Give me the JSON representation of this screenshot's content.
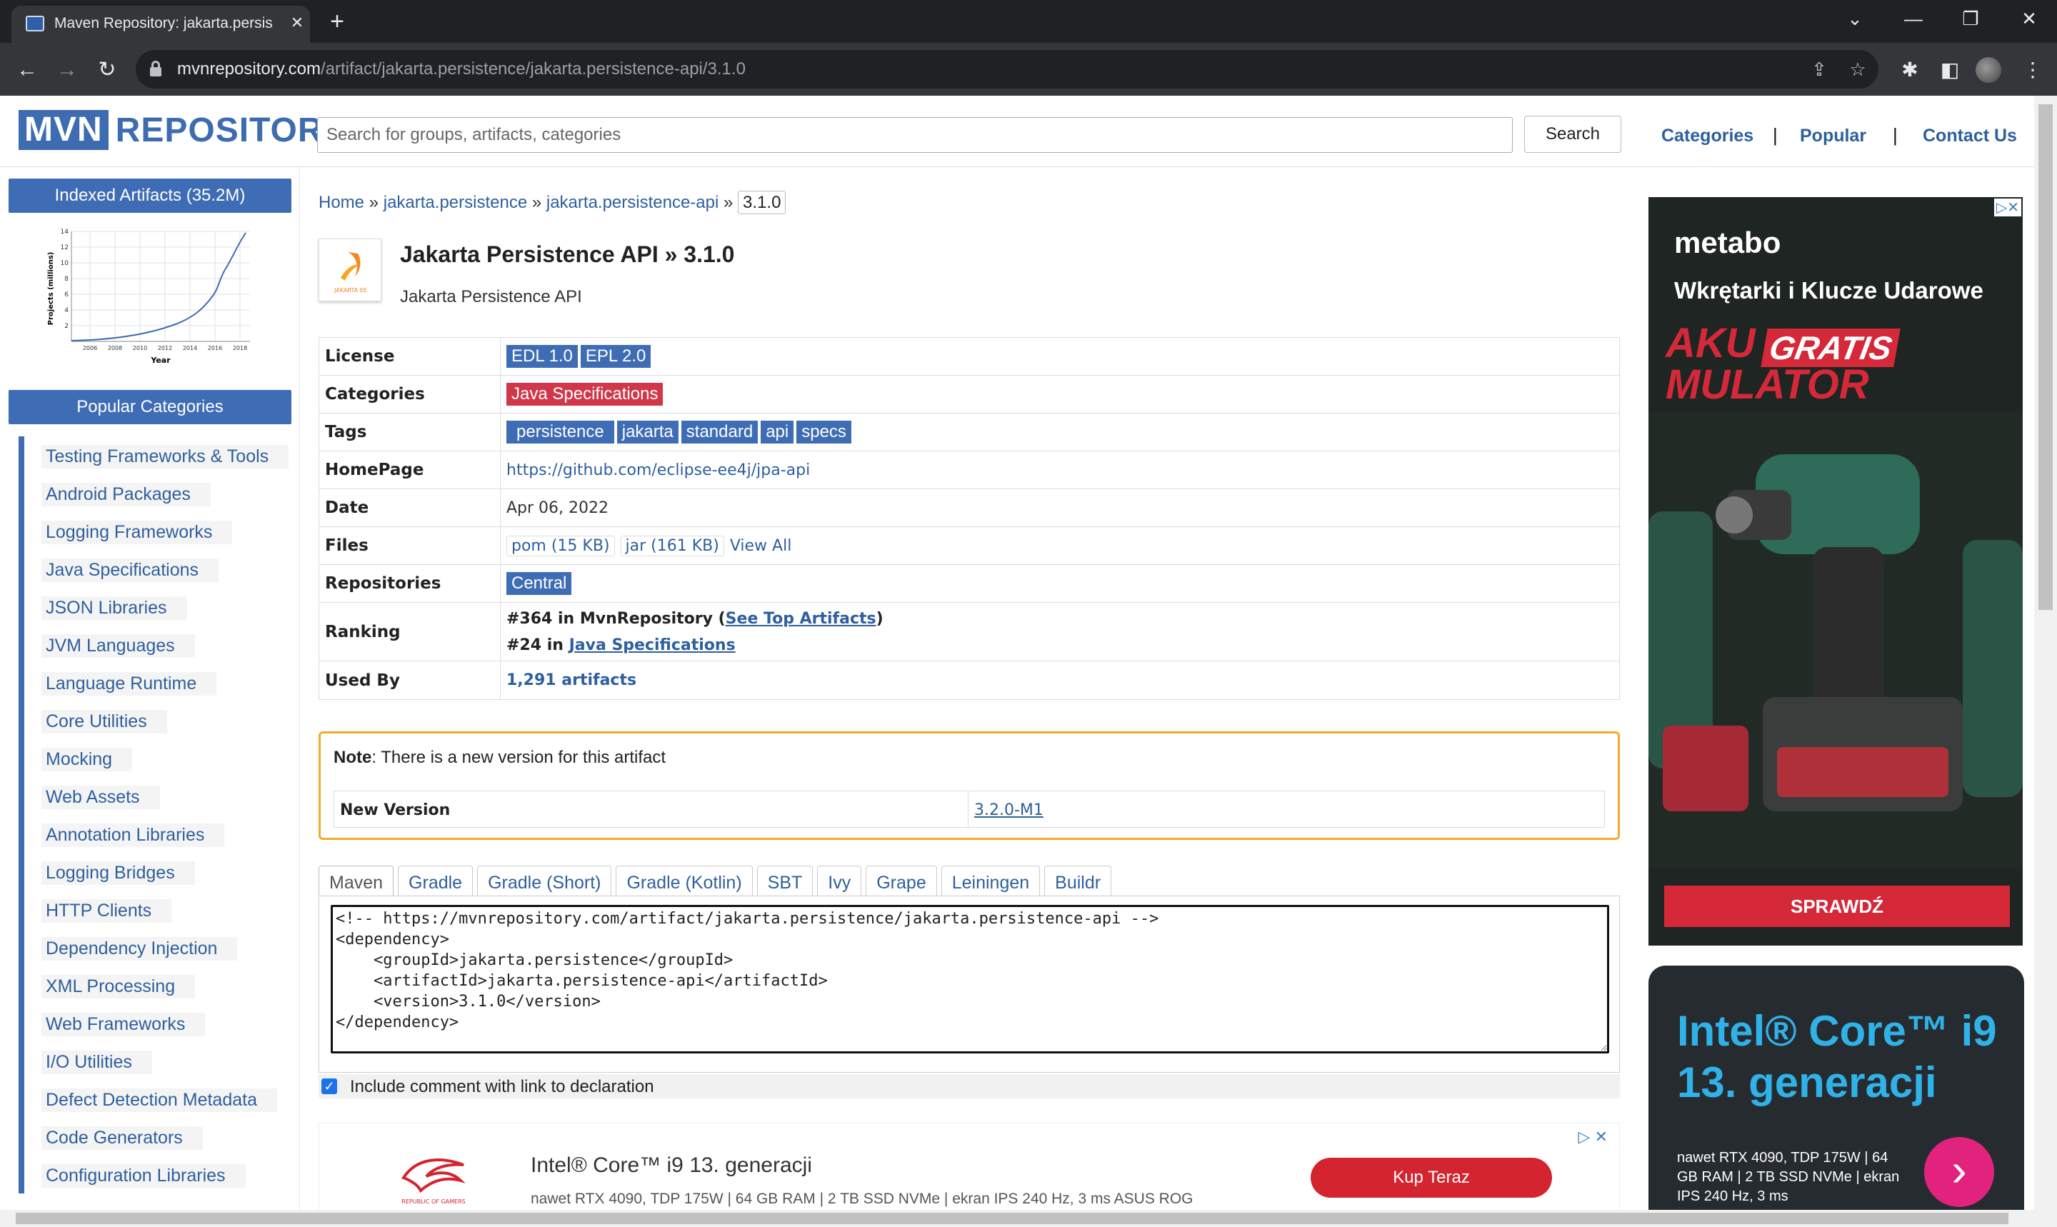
{
  "browser": {
    "tab_title": "Maven Repository: jakarta.persis",
    "url_host": "mvnrepository.com",
    "url_path": "/artifact/jakarta.persistence/jakarta.persistence-api/3.1.0"
  },
  "header": {
    "logo_mvn": "MVN",
    "logo_repository": "REPOSITORY",
    "search_placeholder": "Search for groups, artifacts, categories",
    "search_button": "Search",
    "nav": {
      "categories": "Categories",
      "popular": "Popular",
      "contact": "Contact Us"
    },
    "nav_separator": "|"
  },
  "sidebar": {
    "indexed_title": "Indexed Artifacts (35.2M)",
    "chart": {
      "ylabel": "Projects (millions)",
      "xlabel": "Year",
      "yticks": [
        "14",
        "12",
        "10",
        "8",
        "6",
        "4",
        "2"
      ],
      "xticks": [
        "2006",
        "2008",
        "2010",
        "2012",
        "2014",
        "2016",
        "2018"
      ]
    },
    "popular_title": "Popular Categories",
    "categories": [
      "Testing Frameworks & Tools",
      "Android Packages",
      "Logging Frameworks",
      "Java Specifications",
      "JSON Libraries",
      "JVM Languages",
      "Language Runtime",
      "Core Utilities",
      "Mocking",
      "Web Assets",
      "Annotation Libraries",
      "Logging Bridges",
      "HTTP Clients",
      "Dependency Injection",
      "XML Processing",
      "Web Frameworks",
      "I/O Utilities",
      "Defect Detection Metadata",
      "Code Generators",
      "Configuration Libraries"
    ]
  },
  "breadcrumb": {
    "home": "Home",
    "group": "jakarta.persistence",
    "artifact": "jakarta.persistence-api",
    "version": "3.1.0",
    "sep": "»"
  },
  "artifact": {
    "title": "Jakarta Persistence API » 3.1.0",
    "subtitle": "Jakarta Persistence API",
    "icon_caption": "JAKARTA EE"
  },
  "info": {
    "license_label": "License",
    "licenses": [
      "EDL 1.0",
      "EPL 2.0"
    ],
    "categories_label": "Categories",
    "category": "Java Specifications",
    "tags_label": "Tags",
    "tags": [
      "persistence",
      "jakarta",
      "standard",
      "api",
      "specs"
    ],
    "homepage_label": "HomePage",
    "homepage": "https://github.com/eclipse-ee4j/jpa-api",
    "date_label": "Date",
    "date": "Apr 06, 2022",
    "files_label": "Files",
    "file_pom": "pom (15 KB)",
    "file_jar": "jar (161 KB)",
    "view_all": "View All",
    "repos_label": "Repositories",
    "repo": "Central",
    "ranking_label": "Ranking",
    "rank1_prefix": "#364 in MvnRepository (",
    "rank1_link": "See Top Artifacts",
    "rank1_suffix": ")",
    "rank2_prefix": "#24 in ",
    "rank2_link": "Java Specifications",
    "usedby_label": "Used By",
    "usedby": "1,291 artifacts"
  },
  "note": {
    "bold": "Note",
    "text": ": There is a new version for this artifact",
    "new_version_label": "New Version",
    "new_version": "3.2.0-M1"
  },
  "build_tabs": [
    "Maven",
    "Gradle",
    "Gradle (Short)",
    "Gradle (Kotlin)",
    "SBT",
    "Ivy",
    "Grape",
    "Leiningen",
    "Buildr"
  ],
  "code": "<!-- https://mvnrepository.com/artifact/jakarta.persistence/jakarta.persistence-api -->\n<dependency>\n    <groupId>jakarta.persistence</groupId>\n    <artifactId>jakarta.persistence-api</artifactId>\n    <version>3.1.0</version>\n</dependency>",
  "include_comment_label": "Include comment with link to declaration",
  "bottom_ad": {
    "title": "Intel® Core™ i9 13. generacji",
    "sub": "nawet RTX 4090, TDP 175W | 64 GB RAM | 2 TB SSD NVMe | ekran IPS 240 Hz, 3 ms ASUS ROG",
    "cta": "Kup Teraz",
    "brand": "REPUBLIC OF GAMERS"
  },
  "metabo_ad": {
    "logo": "metabo",
    "headline": "Wkrętarki i Klucze Udarowe",
    "aku": "AKU",
    "gratis": "GRATIS",
    "mulator": "MULATOR",
    "button": "SPRAWDŹ"
  },
  "intel_ad": {
    "title": "Intel® Core™ i9 13. generacji",
    "sub": "nawet RTX 4090, TDP 175W | 64 GB RAM | 2 TB SSD NVMe | ekran IPS 240 Hz, 3 ms"
  },
  "colors": {
    "brand_blue": "#3e6cb5",
    "link": "#2e5f9e",
    "tag_red": "#d0384a",
    "note_border": "#f0ad2c"
  }
}
